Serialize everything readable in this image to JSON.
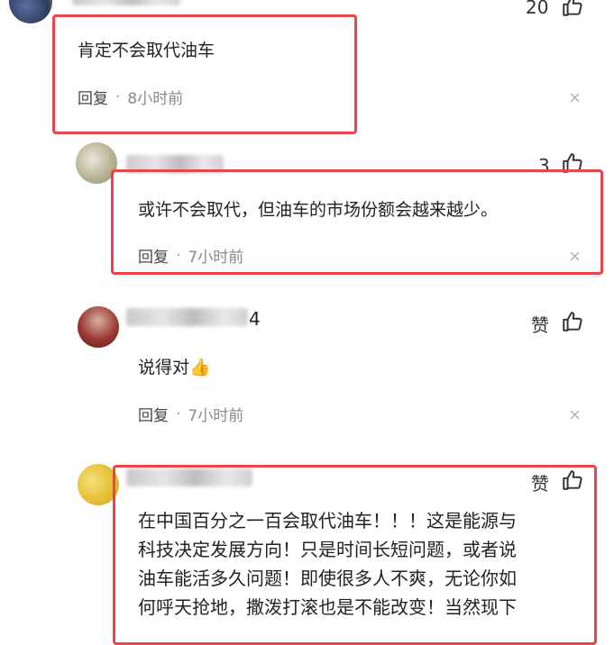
{
  "comments": [
    {
      "like_count": "20",
      "text": "肯定不会取代油车",
      "reply_label": "回复",
      "dot": "·",
      "time": "8小时前",
      "close_glyph": "×"
    },
    {
      "like_count": "3",
      "text": "或许不会取代，但油车的市场份额会越来越少。",
      "reply_label": "回复",
      "dot": "·",
      "time": "7小时前",
      "close_glyph": "×"
    },
    {
      "name_suffix": "4",
      "like_label": "赞",
      "text": "说得对",
      "emoji": "👍",
      "reply_label": "回复",
      "dot": "·",
      "time": "7小时前",
      "close_glyph": "×"
    },
    {
      "like_label": "赞",
      "lines": [
        "在中国百分之一百会取代油车！！！这是能源与",
        "科技决定发展方向！只是时间长短问题，或者说",
        "油车能活多久问题！即使很多人不爽，无论你如",
        "何呼天抢地，撒泼打滚也是不能改变！当然现下"
      ]
    }
  ],
  "colors": {
    "highlight_border": "#e8464a",
    "meta_text": "#8a8a8a",
    "body_text": "#222222"
  }
}
